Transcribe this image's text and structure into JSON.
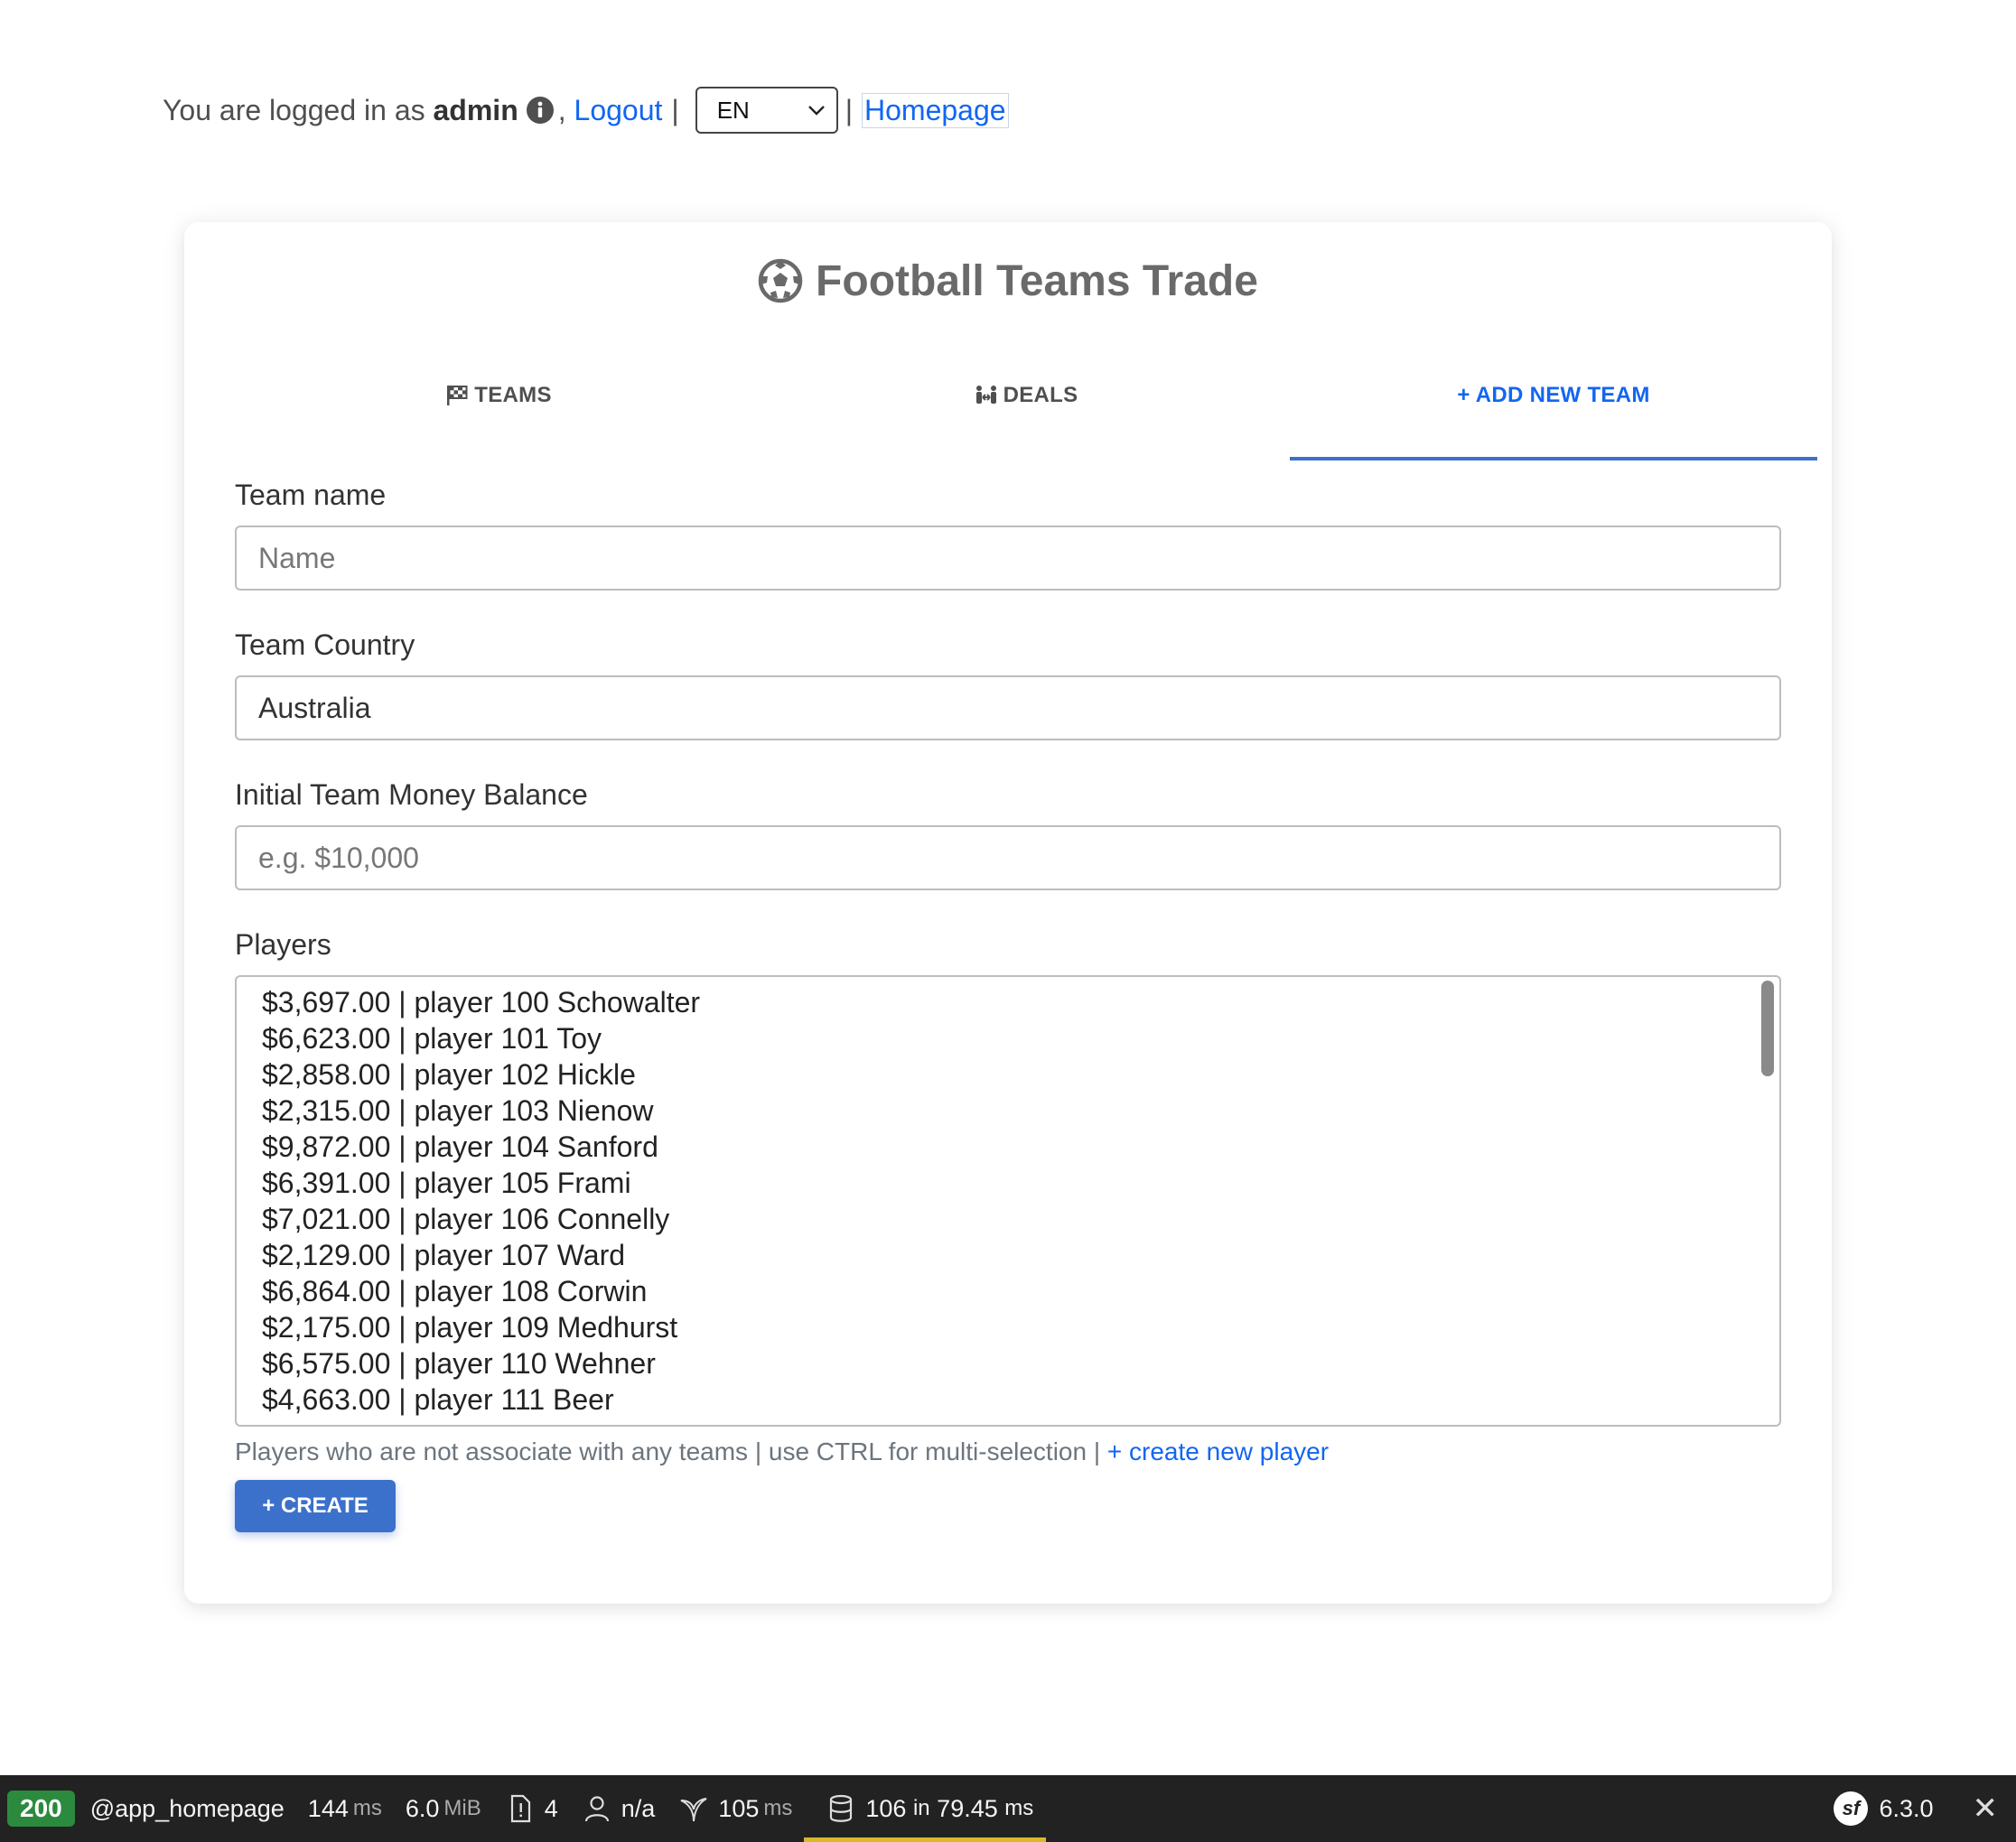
{
  "auth": {
    "prefix": "You are logged in as",
    "username": "admin",
    "comma": ",",
    "logout": "Logout",
    "language": "EN",
    "homepage": "Homepage"
  },
  "card": {
    "title": "Football Teams Trade",
    "tabs": [
      {
        "label": "TEAMS",
        "icon": "flag-checkered-icon"
      },
      {
        "label": "DEALS",
        "icon": "people-arrows-icon"
      },
      {
        "label": "+ ADD NEW TEAM",
        "icon": "plus-icon",
        "active": true
      }
    ]
  },
  "form": {
    "team_name": {
      "label": "Team name",
      "placeholder": "Name"
    },
    "team_country": {
      "label": "Team Country",
      "value": "Australia"
    },
    "balance": {
      "label": "Initial Team Money Balance",
      "placeholder": "e.g. $10,000"
    },
    "players": {
      "label": "Players",
      "options": [
        "$3,697.00 | player 100 Schowalter",
        "$6,623.00 | player 101 Toy",
        "$2,858.00 | player 102 Hickle",
        "$2,315.00 | player 103 Nienow",
        "$9,872.00 | player 104 Sanford",
        "$6,391.00 | player 105 Frami",
        "$7,021.00 | player 106 Connelly",
        "$2,129.00 | player 107 Ward",
        "$6,864.00 | player 108 Corwin",
        "$2,175.00 | player 109 Medhurst",
        "$6,575.00 | player 110 Wehner",
        "$4,663.00 | player 111 Beer"
      ],
      "help_text": "Players who are not associate with any teams | use CTRL for multi-selection |",
      "create_link": "+ create new player"
    },
    "submit": "+ CREATE"
  },
  "toolbar": {
    "status": "200",
    "route": "@app_homepage",
    "time": "144",
    "time_unit": "ms",
    "memory": "6.0",
    "memory_unit": "MiB",
    "logs": "4",
    "user": "n/a",
    "twig_time": "105",
    "twig_unit": "ms",
    "db": "106",
    "db_in": "in",
    "db_time": "79.45",
    "db_unit": "ms",
    "version": "6.3.0",
    "close": "✕"
  },
  "colors": {
    "accent": "#3b71ca",
    "link": "#1266f1",
    "status_ok": "#2b8a3e",
    "toolbar_bg": "#222222"
  }
}
